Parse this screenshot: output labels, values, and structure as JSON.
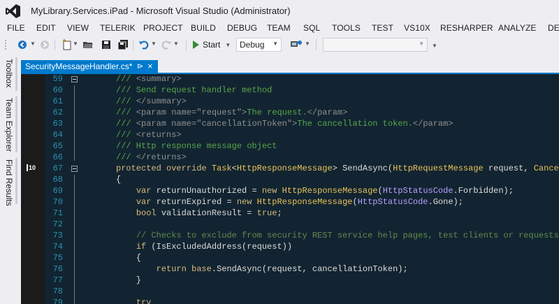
{
  "window": {
    "title": "MyLibrary.Services.iPad - Microsoft Visual Studio (Administrator)"
  },
  "menu": [
    "FILE",
    "EDIT",
    "VIEW",
    "TELERIK",
    "PROJECT",
    "BUILD",
    "DEBUG",
    "TEAM",
    "SQL",
    "TOOLS",
    "TEST",
    "VS10X",
    "RESHARPER",
    "ANALYZE",
    "DEV"
  ],
  "toolbar": {
    "start_label": "Start",
    "configuration": "Debug",
    "platform": ""
  },
  "side_tabs": [
    "Toolbox",
    "Team Explorer",
    "Find Results"
  ],
  "document_tab": {
    "label": "SecurityMessageHandler.cs*",
    "pin": "⊳",
    "close": "×"
  },
  "editor": {
    "reference_count": "10",
    "lines": [
      {
        "num": "59",
        "segments": [
          {
            "t": "/// ",
            "c": "c"
          },
          {
            "t": "<summary>",
            "c": "tg"
          }
        ]
      },
      {
        "num": "60",
        "segments": [
          {
            "t": "/// Send request handler method",
            "c": "c"
          }
        ]
      },
      {
        "num": "61",
        "segments": [
          {
            "t": "/// ",
            "c": "c"
          },
          {
            "t": "</summary>",
            "c": "tg"
          }
        ]
      },
      {
        "num": "62",
        "segments": [
          {
            "t": "/// ",
            "c": "c"
          },
          {
            "t": "<param name=\"",
            "c": "tg"
          },
          {
            "t": "request",
            "c": "tg"
          },
          {
            "t": "\">",
            "c": "tg"
          },
          {
            "t": "The request.",
            "c": "c"
          },
          {
            "t": "</param>",
            "c": "tg"
          }
        ]
      },
      {
        "num": "63",
        "segments": [
          {
            "t": "/// ",
            "c": "c"
          },
          {
            "t": "<param name=\"",
            "c": "tg"
          },
          {
            "t": "cancellationToken",
            "c": "tg"
          },
          {
            "t": "\">",
            "c": "tg"
          },
          {
            "t": "The cancellation token.",
            "c": "c"
          },
          {
            "t": "</param>",
            "c": "tg"
          }
        ]
      },
      {
        "num": "64",
        "segments": [
          {
            "t": "/// ",
            "c": "c"
          },
          {
            "t": "<returns>",
            "c": "tg"
          }
        ]
      },
      {
        "num": "65",
        "segments": [
          {
            "t": "/// Http response message object",
            "c": "c"
          }
        ]
      },
      {
        "num": "66",
        "segments": [
          {
            "t": "/// ",
            "c": "c"
          },
          {
            "t": "</returns>",
            "c": "tg"
          }
        ]
      },
      {
        "num": "67",
        "segments": [
          {
            "t": "protected override ",
            "c": "k"
          },
          {
            "t": "Task",
            "c": "ty"
          },
          {
            "t": "<",
            "c": "id"
          },
          {
            "t": "HttpResponseMessage",
            "c": "ty"
          },
          {
            "t": "> SendAsync(",
            "c": "id"
          },
          {
            "t": "HttpRequestMessage",
            "c": "ty"
          },
          {
            "t": " request, ",
            "c": "id"
          },
          {
            "t": "Cancella",
            "c": "ty"
          }
        ]
      },
      {
        "num": "68",
        "segments": [
          {
            "t": "{",
            "c": "id"
          }
        ]
      },
      {
        "num": "69",
        "segments": [
          {
            "t": "    ",
            "c": "id"
          },
          {
            "t": "var",
            "c": "k"
          },
          {
            "t": " returnUnauthorized = ",
            "c": "id"
          },
          {
            "t": "new ",
            "c": "k"
          },
          {
            "t": "HttpResponseMessage",
            "c": "ty"
          },
          {
            "t": "(",
            "c": "id"
          },
          {
            "t": "HttpStatusCode",
            "c": "kw"
          },
          {
            "t": ".Forbidden);",
            "c": "id"
          }
        ]
      },
      {
        "num": "70",
        "segments": [
          {
            "t": "    ",
            "c": "id"
          },
          {
            "t": "var",
            "c": "k"
          },
          {
            "t": " returnExpired = ",
            "c": "id"
          },
          {
            "t": "new ",
            "c": "k"
          },
          {
            "t": "HttpResponseMessage",
            "c": "ty"
          },
          {
            "t": "(",
            "c": "id"
          },
          {
            "t": "HttpStatusCode",
            "c": "kw"
          },
          {
            "t": ".Gone);",
            "c": "id"
          }
        ]
      },
      {
        "num": "71",
        "segments": [
          {
            "t": "    ",
            "c": "id"
          },
          {
            "t": "bool",
            "c": "k"
          },
          {
            "t": " validationResult = ",
            "c": "id"
          },
          {
            "t": "true",
            "c": "k"
          },
          {
            "t": ";",
            "c": "id"
          }
        ]
      },
      {
        "num": "72",
        "segments": [
          {
            "t": "",
            "c": "id"
          }
        ]
      },
      {
        "num": "73",
        "segments": [
          {
            "t": "    ",
            "c": "id"
          },
          {
            "t": "// Checks to exclude from security REST service help pages, test clients or requests th",
            "c": "cx"
          }
        ]
      },
      {
        "num": "74",
        "segments": [
          {
            "t": "    ",
            "c": "id"
          },
          {
            "t": "if",
            "c": "k"
          },
          {
            "t": " (IsExcludedAddress(request))",
            "c": "id"
          }
        ]
      },
      {
        "num": "75",
        "segments": [
          {
            "t": "    {",
            "c": "id"
          }
        ]
      },
      {
        "num": "76",
        "segments": [
          {
            "t": "        ",
            "c": "id"
          },
          {
            "t": "return",
            "c": "k"
          },
          {
            "t": " ",
            "c": "id"
          },
          {
            "t": "base",
            "c": "k"
          },
          {
            "t": ".SendAsync(request, cancellationToken);",
            "c": "id"
          }
        ]
      },
      {
        "num": "77",
        "segments": [
          {
            "t": "    }",
            "c": "id"
          }
        ]
      },
      {
        "num": "78",
        "segments": [
          {
            "t": "",
            "c": "id"
          }
        ]
      },
      {
        "num": "79",
        "segments": [
          {
            "t": "    ",
            "c": "id"
          },
          {
            "t": "try",
            "c": "k"
          }
        ]
      }
    ]
  }
}
